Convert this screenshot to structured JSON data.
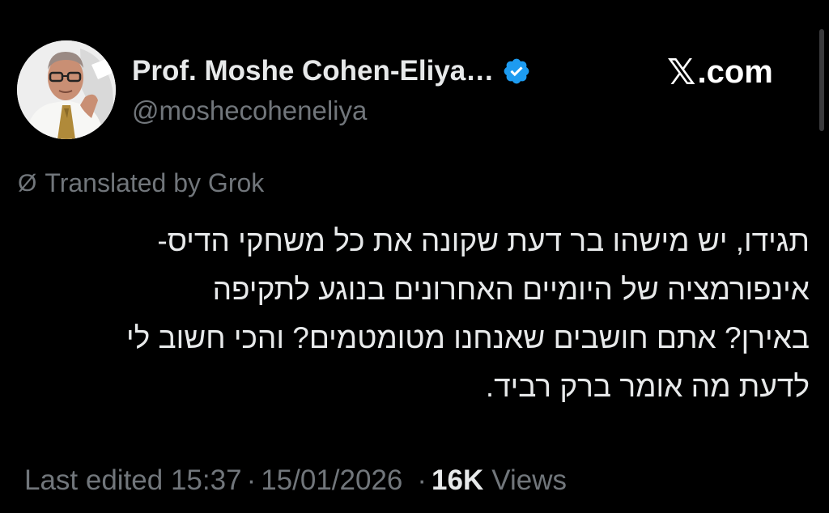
{
  "author": {
    "display_name": "Prof. Moshe Cohen-Eliya…",
    "handle": "@moshecoheneliya",
    "verified_icon": "verified-badge-icon",
    "avatar_icon": "avatar-photo"
  },
  "site": {
    "label": ".com",
    "x_glyph": "𝕏",
    "logo_icon": "x-logo-icon"
  },
  "translation": {
    "icon": "translate-slash-icon",
    "icon_glyph": "Ø",
    "label": "Translated by Grok"
  },
  "tweet": {
    "lines": [
      "תגידו, יש מישהו בר דעת שקונה את כל משחקי הדיס-",
      "אינפורמציה של היומיים האחרונים בנוגע לתקיפה",
      "באירן? אתם חושבים שאנחנו מטומטמים? והכי חשוב לי",
      "לדעת מה אומר ברק רביד."
    ]
  },
  "meta": {
    "edited": "Last edited 15:37",
    "separator": "·",
    "date": "15/01/2026",
    "views_count": "16K",
    "views_label": "Views"
  },
  "colors": {
    "background": "#000000",
    "primary_text": "#e7e9ea",
    "secondary_text": "#71767b",
    "verified_blue": "#1d9bf0"
  }
}
